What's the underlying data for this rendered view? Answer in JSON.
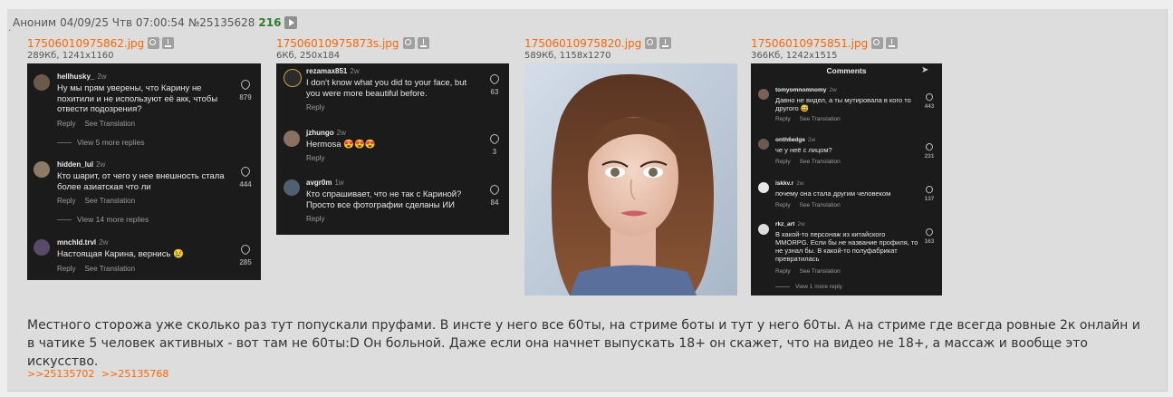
{
  "post": {
    "name": "Аноним",
    "datetime": "04/09/25 Чтв 07:00:54",
    "number": "№25135628",
    "reply_count": "216",
    "message": "Местного сторожа уже сколько раз тут попускали пруфами. В инсте у него все 60ты, на стриме боты и тут у него 60ты. А на стриме где всегда ровные 2к онлайн и в чатике 5 человек активных - вот там не 60ты:D Он больной. Даже если она начнет выпускать 18+ он скажет, что на видео не 18+, а массаж и вообще это искусство.",
    "replies": [
      ">>25135702",
      ">>25135768"
    ]
  },
  "files": [
    {
      "name": "17506010975862.jpg",
      "info": "289Кб, 1241x1160",
      "comments": [
        {
          "user": "hellhusky_",
          "ago": "2w",
          "text": "Ну мы прям уверены, что Карину не похитили и не используют её акк, чтобы отвести подозрения?",
          "likes": "879",
          "reply": "Reply",
          "translate": "See Translation"
        },
        {
          "user": "hidden_lul",
          "ago": "2w",
          "text": "Кто шарит, от чего у нее внешность стала более азиатская что ли",
          "likes": "444",
          "reply": "Reply",
          "translate": "See Translation"
        },
        {
          "user": "mnchld.trvl",
          "ago": "2w",
          "text": "Настоящая Карина, вернись 😢",
          "likes": "285",
          "reply": "Reply",
          "translate": "See Translation"
        }
      ],
      "view_more": [
        "View 5 more replies",
        "View 14 more replies"
      ]
    },
    {
      "name": "17506010975873s.jpg",
      "info": "6Кб, 250x184",
      "comments": [
        {
          "user": "rezamax851",
          "ago": "2w",
          "text": "I don't know what you did to your face, but you were more beautiful before.",
          "likes": "63",
          "reply": "Reply"
        },
        {
          "user": "jzhungo",
          "ago": "2w",
          "text": "Hermosa 😍😍😍",
          "likes": "3",
          "reply": "Reply"
        },
        {
          "user": "avgr0m",
          "ago": "1w",
          "text": "Кто спрашивает, что не так с Кариной? Просто все фотографии сделаны ИИ",
          "likes": "84",
          "reply": "Reply"
        }
      ]
    },
    {
      "name": "17506010975820.jpg",
      "info": "589Кб, 1158x1270"
    },
    {
      "name": "17506010975851.jpg",
      "info": "366Кб, 1242x1515",
      "header": "Comments",
      "comments": [
        {
          "user": "tomyomnomnomy",
          "ago": "2w",
          "text": "Давно не видел, а ты мутировала в кого то другого 😅",
          "likes": "443",
          "reply": "Reply",
          "translate": "See Translation"
        },
        {
          "user": "onth6edge",
          "ago": "2w",
          "text": "че у неё с лицом?",
          "likes": "231",
          "reply": "Reply",
          "translate": "See Translation"
        },
        {
          "user": "iskkv.r",
          "ago": "2w",
          "text": "почему она стала другим человеком",
          "likes": "137",
          "reply": "Reply",
          "translate": "See Translation"
        },
        {
          "user": "rkz_art",
          "ago": "2w",
          "text": "В какой-то персонаж из китайского MMORPG. Если бы не название профиля, то не узнал бы. В какой-то полуфабрикат превратилась",
          "likes": "163",
          "reply": "Reply",
          "translate": "See Translation"
        }
      ],
      "view_more": [
        "View 1 more reply"
      ]
    }
  ],
  "colors": {
    "page_bg": "#eeeeee",
    "post_bg": "#dddddd",
    "link": "#ff6600",
    "reply_count": "#2e7d2e",
    "thumb_bg": "#1b1b1b"
  }
}
